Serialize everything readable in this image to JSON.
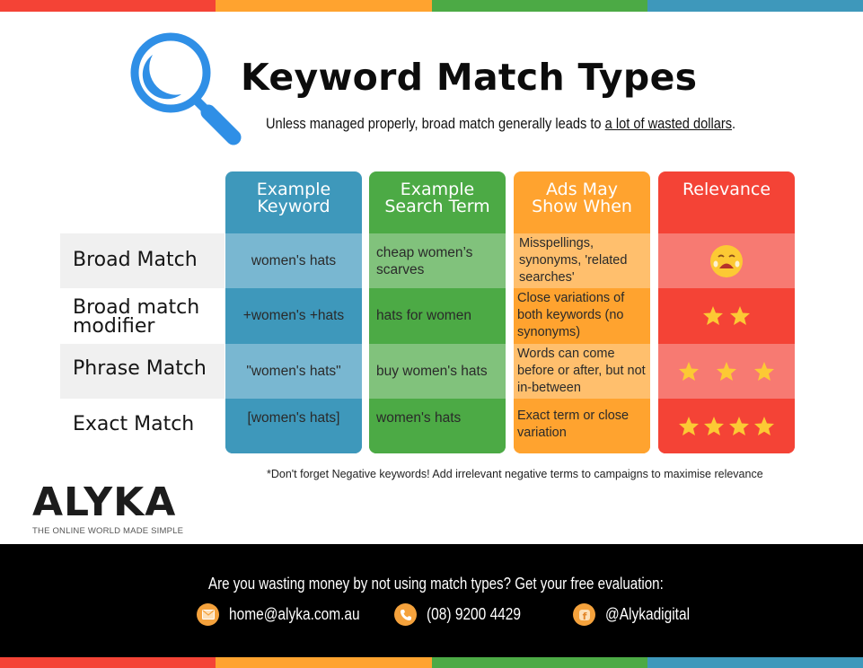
{
  "colors": {
    "red": "#f44336",
    "orange": "#ffa32f",
    "green": "#4caa45",
    "blue": "#3e98bb",
    "magnifier": "#2f8fe6",
    "star": "#fcc934"
  },
  "header": {
    "icon": "magnifier-icon",
    "title": "Keyword Match Types",
    "subtitle_prefix": "Unless managed properly, broad match generally leads to ",
    "subtitle_emphasis": "a lot of wasted dollars",
    "subtitle_suffix": "."
  },
  "table": {
    "columns": [
      {
        "label_line1": "Example",
        "label_line2": "Keyword"
      },
      {
        "label_line1": "Example",
        "label_line2": "Search Term"
      },
      {
        "label_line1": "Ads May",
        "label_line2": "Show When"
      },
      {
        "label_line1": "Relevance",
        "label_line2": ""
      }
    ],
    "rows": [
      {
        "label_line1": "Broad Match",
        "label_line2": "",
        "keyword": "women's hats",
        "search_term": "cheap women’s scarves",
        "show_when": "Misspellings, synonyms, 'related searches'",
        "relevance_icon": "crying-face-icon",
        "relevance_stars": 0
      },
      {
        "label_line1": "Broad match",
        "label_line2": "modifier",
        "keyword": "+women's +hats",
        "search_term": "hats for women",
        "show_when": "Close variations of both keywords (no synonyms)",
        "relevance_icon": "star-icon",
        "relevance_stars": 2
      },
      {
        "label_line1": "Phrase Match",
        "label_line2": "",
        "keyword": "\"women's hats\"",
        "search_term": "buy women's hats",
        "show_when": "Words can come before or after, but not in-between",
        "relevance_icon": "star-icon",
        "relevance_stars": 3
      },
      {
        "label_line1": "Exact Match",
        "label_line2": "",
        "keyword": "[women's hats]",
        "search_term": "women's hats",
        "show_when": "Exact term or close variation",
        "relevance_icon": "star-icon",
        "relevance_stars": 4
      }
    ]
  },
  "note": "*Don't forget Negative keywords! Add irrelevant negative terms to campaigns to maximise relevance",
  "brand": {
    "name": "ALYKA",
    "tagline": "THE ONLINE WORLD MADE SIMPLE"
  },
  "footer": {
    "cta": "Are you wasting money by not using match types? Get your free evaluation:",
    "contacts": [
      {
        "icon": "email-icon",
        "text": "home@alyka.com.au"
      },
      {
        "icon": "phone-icon",
        "text": "(08) 9200 4429"
      },
      {
        "icon": "facebook-icon",
        "text": "@Alykadigital"
      }
    ]
  }
}
